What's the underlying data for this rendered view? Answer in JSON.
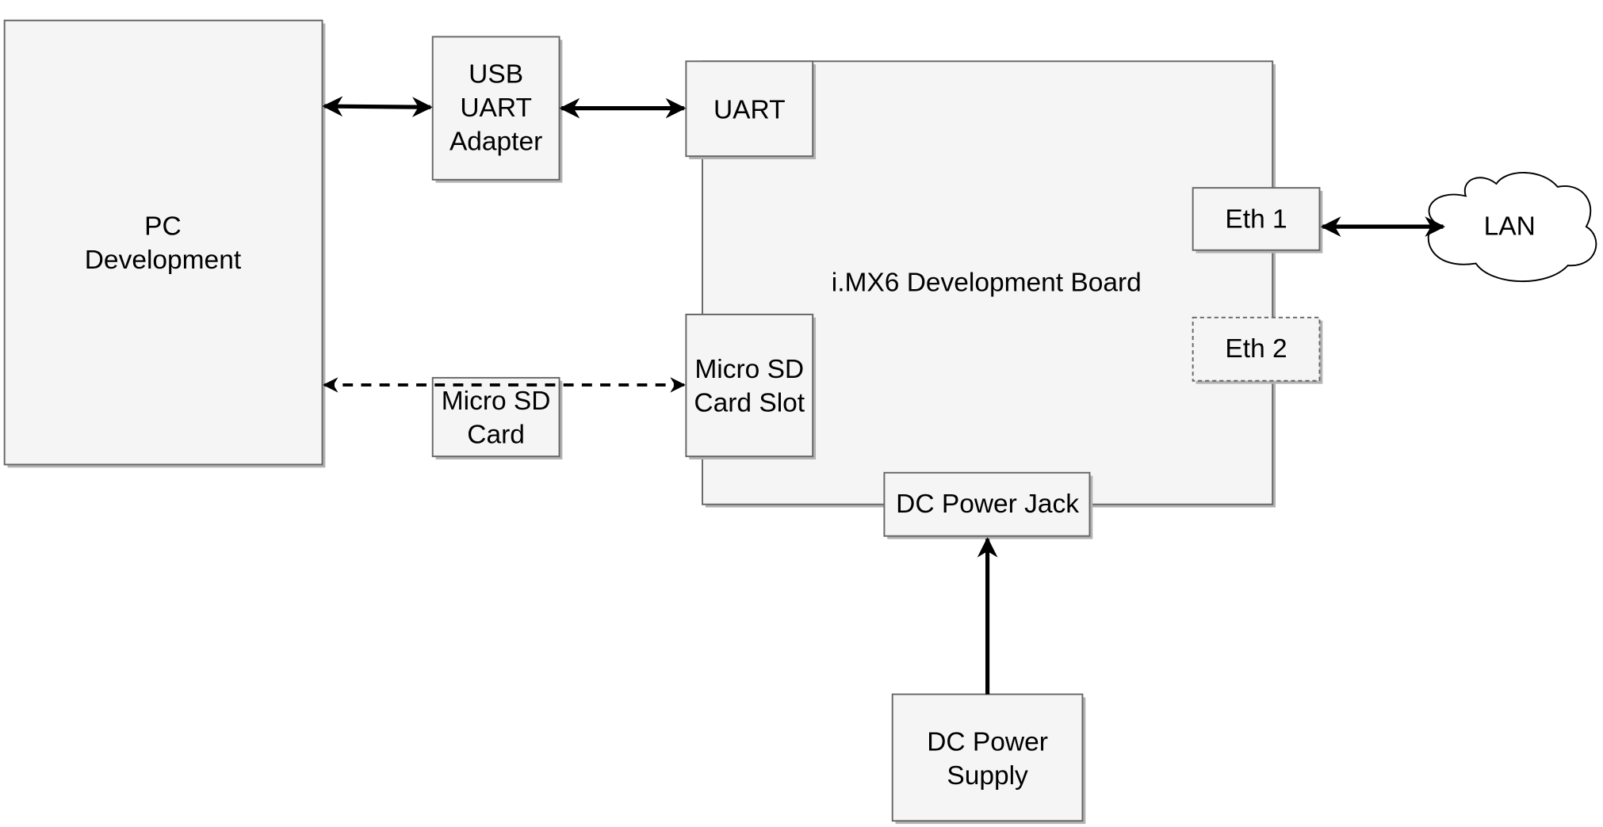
{
  "nodes": {
    "pc": {
      "lines": [
        "PC",
        "Development"
      ]
    },
    "usb_uart": {
      "lines": [
        "USB",
        "UART",
        "Adapter"
      ]
    },
    "board": {
      "label": "i.MX6 Development Board"
    },
    "uart": {
      "label": "UART"
    },
    "sd_slot": {
      "lines": [
        "Micro SD",
        "Card Slot"
      ]
    },
    "eth1": {
      "label": "Eth 1"
    },
    "eth2": {
      "label": "Eth 2"
    },
    "power_jack": {
      "label": "DC Power Jack"
    },
    "power_supply": {
      "lines": [
        "DC Power",
        "Supply"
      ]
    },
    "sd_card": {
      "lines": [
        "Micro SD",
        "Card"
      ]
    },
    "lan": {
      "label": "LAN"
    }
  },
  "edges": [
    {
      "from": "pc",
      "to": "usb_uart",
      "style": "solid",
      "direction": "both"
    },
    {
      "from": "usb_uart",
      "to": "uart",
      "style": "solid",
      "direction": "both"
    },
    {
      "from": "pc",
      "to": "sd_slot",
      "style": "dashed",
      "direction": "both",
      "via": "sd_card"
    },
    {
      "from": "eth1",
      "to": "lan",
      "style": "solid",
      "direction": "both"
    },
    {
      "from": "power_supply",
      "to": "power_jack",
      "style": "solid",
      "direction": "forward"
    }
  ],
  "colors": {
    "fill": "#f5f5f5",
    "stroke": "#666666",
    "shadow": "#b3b3b3",
    "edge": "#000000"
  }
}
